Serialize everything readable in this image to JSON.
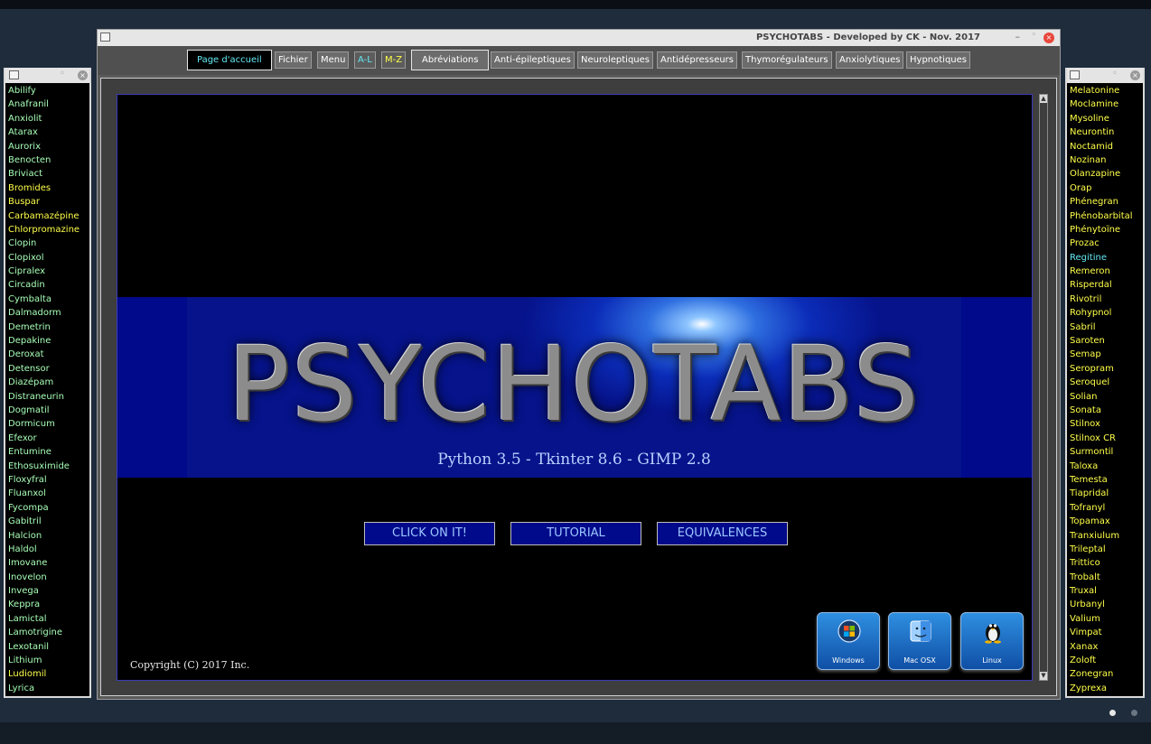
{
  "left_list": {
    "items": [
      {
        "label": "Abilify",
        "color": "#a8ffb6"
      },
      {
        "label": "Anafranil",
        "color": "#a8ffb6"
      },
      {
        "label": "Anxiolit",
        "color": "#a8ffb6"
      },
      {
        "label": "Atarax",
        "color": "#a8ffb6"
      },
      {
        "label": "Aurorix",
        "color": "#a8ffb6"
      },
      {
        "label": "Benocten",
        "color": "#a8ffb6"
      },
      {
        "label": "Briviact",
        "color": "#a8ffb6"
      },
      {
        "label": "Bromides",
        "color": "#ffff4a"
      },
      {
        "label": "Buspar",
        "color": "#ffff4a"
      },
      {
        "label": "Carbamazépine",
        "color": "#ffff4a"
      },
      {
        "label": "Chlorpromazine",
        "color": "#ffff4a"
      },
      {
        "label": "Clopin",
        "color": "#a8ffb6"
      },
      {
        "label": "Clopixol",
        "color": "#a8ffb6"
      },
      {
        "label": "Cipralex",
        "color": "#a8ffb6"
      },
      {
        "label": "Circadin",
        "color": "#a8ffb6"
      },
      {
        "label": "Cymbalta",
        "color": "#a8ffb6"
      },
      {
        "label": "Dalmadorm",
        "color": "#a8ffb6"
      },
      {
        "label": "Demetrin",
        "color": "#a8ffb6"
      },
      {
        "label": "Depakine",
        "color": "#a8ffb6"
      },
      {
        "label": "Deroxat",
        "color": "#a8ffb6"
      },
      {
        "label": "Detensor",
        "color": "#a8ffb6"
      },
      {
        "label": "Diazépam",
        "color": "#a8ffb6"
      },
      {
        "label": "Distraneurin",
        "color": "#a8ffb6"
      },
      {
        "label": "Dogmatil",
        "color": "#a8ffb6"
      },
      {
        "label": "Dormicum",
        "color": "#a8ffb6"
      },
      {
        "label": "Efexor",
        "color": "#a8ffb6"
      },
      {
        "label": "Entumine",
        "color": "#a8ffb6"
      },
      {
        "label": "Ethosuximide",
        "color": "#a8ffb6"
      },
      {
        "label": "Floxyfral",
        "color": "#a8ffb6"
      },
      {
        "label": "Fluanxol",
        "color": "#a8ffb6"
      },
      {
        "label": "Fycompa",
        "color": "#a8ffb6"
      },
      {
        "label": "Gabitril",
        "color": "#a8ffb6"
      },
      {
        "label": "Halcion",
        "color": "#a8ffb6"
      },
      {
        "label": "Haldol",
        "color": "#a8ffb6"
      },
      {
        "label": "Imovane",
        "color": "#a8ffb6"
      },
      {
        "label": "Inovelon",
        "color": "#a8ffb6"
      },
      {
        "label": "Invega",
        "color": "#a8ffb6"
      },
      {
        "label": "Keppra",
        "color": "#a8ffb6"
      },
      {
        "label": "Lamictal",
        "color": "#a8ffb6"
      },
      {
        "label": "Lamotrigine",
        "color": "#a8ffb6"
      },
      {
        "label": "Lexotanil",
        "color": "#a8ffb6"
      },
      {
        "label": "Lithium",
        "color": "#a8ffb6"
      },
      {
        "label": "Ludiomil",
        "color": "#ffff4a"
      },
      {
        "label": "Lyrica",
        "color": "#a8ffb6"
      }
    ]
  },
  "right_list": {
    "items": [
      {
        "label": "Melatonine",
        "color": "#ffff4a"
      },
      {
        "label": "Moclamine",
        "color": "#ffff4a"
      },
      {
        "label": "Mysoline",
        "color": "#ffff4a"
      },
      {
        "label": "Neurontin",
        "color": "#ffff4a"
      },
      {
        "label": "Noctamid",
        "color": "#ffff4a"
      },
      {
        "label": "Nozinan",
        "color": "#ffff4a"
      },
      {
        "label": "Olanzapine",
        "color": "#ffff4a"
      },
      {
        "label": "Orap",
        "color": "#ffff4a"
      },
      {
        "label": "Phénegran",
        "color": "#ffff4a"
      },
      {
        "label": "Phénobarbital",
        "color": "#ffff4a"
      },
      {
        "label": "Phénytoïne",
        "color": "#ffff4a"
      },
      {
        "label": "Prozac",
        "color": "#ffff4a"
      },
      {
        "label": "Regitine",
        "color": "#63e8f2"
      },
      {
        "label": "Remeron",
        "color": "#ffff4a"
      },
      {
        "label": "Risperdal",
        "color": "#ffff4a"
      },
      {
        "label": "Rivotril",
        "color": "#ffff4a"
      },
      {
        "label": "Rohypnol",
        "color": "#ffff4a"
      },
      {
        "label": "Sabril",
        "color": "#ffff4a"
      },
      {
        "label": "Saroten",
        "color": "#ffff4a"
      },
      {
        "label": "Semap",
        "color": "#ffff4a"
      },
      {
        "label": "Seropram",
        "color": "#ffff4a"
      },
      {
        "label": "Seroquel",
        "color": "#ffff4a"
      },
      {
        "label": "Solian",
        "color": "#ffff4a"
      },
      {
        "label": "Sonata",
        "color": "#ffff4a"
      },
      {
        "label": "Stilnox",
        "color": "#ffff4a"
      },
      {
        "label": "Stilnox CR",
        "color": "#ffff4a"
      },
      {
        "label": "Surmontil",
        "color": "#ffff4a"
      },
      {
        "label": "Taloxa",
        "color": "#ffff4a"
      },
      {
        "label": "Temesta",
        "color": "#ffff4a"
      },
      {
        "label": "Tiapridal",
        "color": "#ffff4a"
      },
      {
        "label": "Tofranyl",
        "color": "#ffff4a"
      },
      {
        "label": "Topamax",
        "color": "#ffff4a"
      },
      {
        "label": "Tranxiulum",
        "color": "#ffff4a"
      },
      {
        "label": "Trileptal",
        "color": "#ffff4a"
      },
      {
        "label": "Trittico",
        "color": "#ffff4a"
      },
      {
        "label": "Trobalt",
        "color": "#ffff4a"
      },
      {
        "label": "Truxal",
        "color": "#ffff4a"
      },
      {
        "label": "Urbanyl",
        "color": "#ffff4a"
      },
      {
        "label": "Valium",
        "color": "#ffff4a"
      },
      {
        "label": "Vimpat",
        "color": "#ffff4a"
      },
      {
        "label": "Xanax",
        "color": "#ffff4a"
      },
      {
        "label": "Zoloft",
        "color": "#ffff4a"
      },
      {
        "label": "Zonegran",
        "color": "#ffff4a"
      },
      {
        "label": "Zyprexa",
        "color": "#ffff4a"
      }
    ]
  },
  "window": {
    "title": "PSYCHOTABS - Developed by CK - Nov. 2017"
  },
  "menu": {
    "home": "Page d'accueil",
    "fichier": "Fichier",
    "menu": "Menu",
    "al": "A-L",
    "mz": "M-Z",
    "abreviations": "Abréviations",
    "anti_epileptiques": "Anti-épileptiques",
    "neuroleptiques": "Neuroleptiques",
    "antidepresseurs": "Antidépresseurs",
    "thymoregulateurs": "Thymorégulateurs",
    "anxiolytiques": "Anxiolytiques",
    "hypnotiques": "Hypnotiques"
  },
  "banner": {
    "logo": "PSYCHOTABS",
    "version": "Python 3.5 - Tkinter 8.6 - GIMP 2.8"
  },
  "actions": {
    "click_on_it": "CLICK ON IT!",
    "tutorial": "TUTORIAL",
    "equivalences": "EQUIVALENCES"
  },
  "os_buttons": {
    "windows": "Windows",
    "mac": "Mac OSX",
    "linux": "Linux"
  },
  "copyright": "Copyright (C) 2017 Inc.",
  "colors": {
    "green_item": "#a8ffb6",
    "yellow_item": "#ffff4a",
    "cyan_item": "#63e8f2",
    "banner_blue": "#000a8a"
  }
}
